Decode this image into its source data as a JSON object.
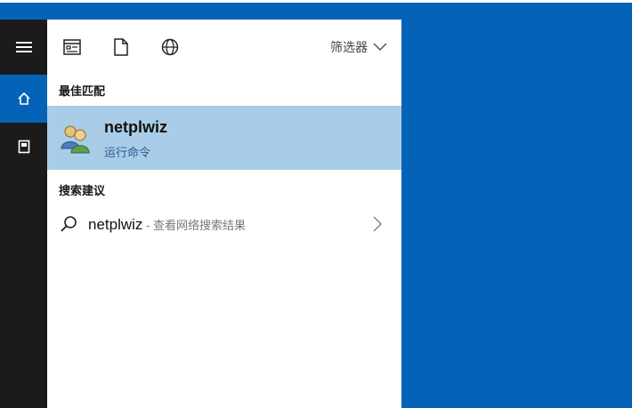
{
  "toolbar": {
    "filter_label": "筛选器",
    "icons": [
      "apps-icon",
      "document-icon",
      "web-globe-icon"
    ]
  },
  "rail": {
    "icons": [
      "hamburger-menu-icon",
      "home-icon",
      "user-documents-icon"
    ],
    "active": "home-icon"
  },
  "best_match": {
    "section_label": "最佳匹配",
    "title": "netplwiz",
    "subtitle": "运行命令",
    "icon": "users-icon"
  },
  "suggestions": {
    "section_label": "搜索建议",
    "items": [
      {
        "query": "netplwiz",
        "suffix": " - 查看网络搜索结果",
        "icon": "search-icon"
      }
    ]
  },
  "colors": {
    "accent": "#0563b7",
    "rail": "#1b1b1b",
    "highlight": "#a9cde8"
  }
}
